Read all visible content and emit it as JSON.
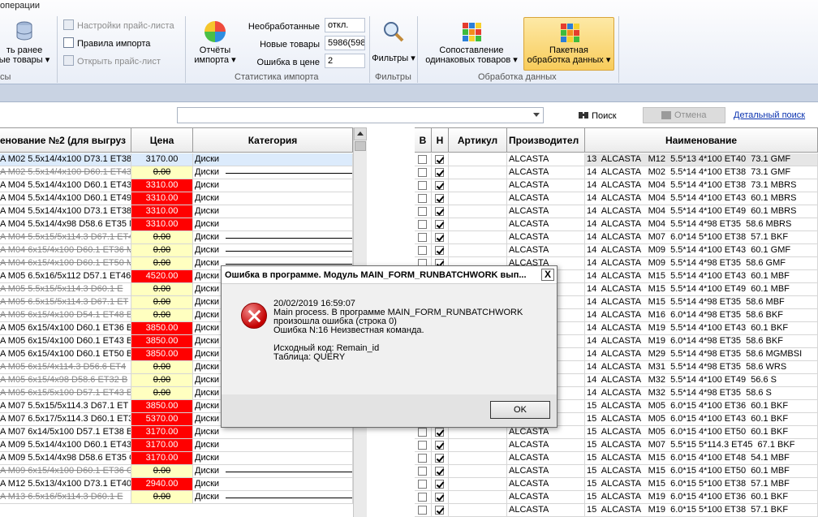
{
  "menu_label": "операции",
  "ribbon": {
    "group1": {
      "load_btn_line1": "ть ранее",
      "load_btn_line2": "ые товары",
      "caption": "сы",
      "items": [
        {
          "label": "Настройки прайс-листа",
          "disabled": true
        },
        {
          "label": "Правила импорта",
          "disabled": false
        },
        {
          "label": "Открыть прайс-лист",
          "disabled": true
        }
      ]
    },
    "stats": {
      "reports_line1": "Отчёты",
      "reports_line2": "импорта",
      "labels": [
        "Необработанные",
        "Новые товары",
        "Ошибка в цене"
      ],
      "values": [
        "откл.",
        "5986(598",
        "2"
      ],
      "caption": "Статистика импорта"
    },
    "filters": {
      "label": "Фильтры",
      "caption": "Фильтры"
    },
    "processing": {
      "compare_line1": "Сопоставление",
      "compare_line2": "одинаковых товаров",
      "batch_line1": "Пакетная",
      "batch_line2": "обработка данных",
      "caption": "Обработка данных"
    }
  },
  "toolbar": {
    "search_label": "Поиск",
    "cancel_label": "Отмена",
    "detail_link": "Детальный поиск"
  },
  "left_grid": {
    "headers": [
      "енование №2 (для выгруз",
      "Цена",
      "Категория"
    ],
    "rows": [
      {
        "name": "A M02 5.5x14/4x100 D73.1 ET38",
        "price": "3170.00",
        "ptype": "norm",
        "cat": "Диски",
        "struck": false
      },
      {
        "name": "A M02 5.5x14/4x100 D60.1 ET43",
        "price": "0.00",
        "ptype": "yel",
        "cat": "Диски",
        "struck": true
      },
      {
        "name": "A M04 5.5x14/4x100 D60.1 ET43",
        "price": "3310.00",
        "ptype": "red",
        "cat": "Диски",
        "struck": false
      },
      {
        "name": "A M04 5.5x14/4x100 D60.1 ET49",
        "price": "3310.00",
        "ptype": "red",
        "cat": "Диски",
        "struck": false
      },
      {
        "name": "A M04 5.5x14/4x100 D73.1 ET38",
        "price": "3310.00",
        "ptype": "red",
        "cat": "Диски",
        "struck": false
      },
      {
        "name": "A M04 5.5x14/4x98 D58.6 ET35 M",
        "price": "3310.00",
        "ptype": "red",
        "cat": "Диски",
        "struck": false
      },
      {
        "name": "A M04 5.5x15/5x114.3 D67.1 ET4",
        "price": "0.00",
        "ptype": "yel",
        "cat": "Диски",
        "struck": true
      },
      {
        "name": "A M04 6x15/4x100 D60.1 ET36 M",
        "price": "0.00",
        "ptype": "yel",
        "cat": "Диски",
        "struck": true
      },
      {
        "name": "A M04 6x15/4x100 D60.1 ET50 M",
        "price": "0.00",
        "ptype": "yel",
        "cat": "Диски",
        "struck": true
      },
      {
        "name": "A M05 6.5x16/5x112 D57.1 ET46",
        "price": "4520.00",
        "ptype": "red",
        "cat": "Диски",
        "struck": false
      },
      {
        "name": "A M05 5.5x15/5x114.3 D60.1 E",
        "price": "0.00",
        "ptype": "yel",
        "cat": "Диски",
        "struck": true
      },
      {
        "name": "A M05 6.5x15/5x114.3 D67.1 ET",
        "price": "0.00",
        "ptype": "yel",
        "cat": "Диски",
        "struck": true
      },
      {
        "name": "A M05 6x15/4x100 D54.1 ET48 B",
        "price": "0.00",
        "ptype": "yel",
        "cat": "Диски",
        "struck": true
      },
      {
        "name": "A M05 6x15/4x100 D60.1 ET36 BK",
        "price": "3850.00",
        "ptype": "red",
        "cat": "Диски",
        "struck": false
      },
      {
        "name": "A M05 6x15/4x100 D60.1 ET43 BK",
        "price": "3850.00",
        "ptype": "red",
        "cat": "Диски",
        "struck": false
      },
      {
        "name": "A M05 6x15/4x100 D60.1 ET50 BK",
        "price": "3850.00",
        "ptype": "red",
        "cat": "Диски",
        "struck": false
      },
      {
        "name": "A M05 6x15/4x114.3 D56.6 ET4",
        "price": "0.00",
        "ptype": "yel",
        "cat": "Диски",
        "struck": true
      },
      {
        "name": "A M05 6x15/4x98 D58.6 ET32 B",
        "price": "0.00",
        "ptype": "yel",
        "cat": "Диски",
        "struck": true
      },
      {
        "name": "A M05 6x15/5x100 D57.1 ET43 B",
        "price": "0.00",
        "ptype": "yel",
        "cat": "Диски",
        "struck": true
      },
      {
        "name": "A M07 5.5x15/5x114.3 D67.1 ET",
        "price": "3850.00",
        "ptype": "red",
        "cat": "Диски",
        "struck": false
      },
      {
        "name": "A M07 6.5x17/5x114.3 D60.1 ET3",
        "price": "5370.00",
        "ptype": "red",
        "cat": "Диски",
        "struck": false
      },
      {
        "name": "A M07 6x14/5x100 D57.1 ET38 BK",
        "price": "3170.00",
        "ptype": "red",
        "cat": "Диски",
        "struck": false
      },
      {
        "name": "A M09 5.5x14/4x100 D60.1 ET43",
        "price": "3170.00",
        "ptype": "red",
        "cat": "Диски",
        "struck": false
      },
      {
        "name": "A M09 5.5x14/4x98 D58.6 ET35 G",
        "price": "3170.00",
        "ptype": "red",
        "cat": "Диски",
        "struck": false
      },
      {
        "name": "A M09 6x15/4x100 D60.1 ET36 G",
        "price": "0.00",
        "ptype": "yel",
        "cat": "Диски",
        "struck": true
      },
      {
        "name": "A M12 5.5x13/4x100 D73.1 ET40",
        "price": "2940.00",
        "ptype": "red",
        "cat": "Диски",
        "struck": false
      },
      {
        "name": "A M13 6.5x16/5x114.3 D60.1 E",
        "price": "0.00",
        "ptype": "yel",
        "cat": "Диски",
        "struck": true
      }
    ]
  },
  "right_grid": {
    "headers": [
      "В",
      "Н",
      "Артикул",
      "Производител",
      "Наименование"
    ],
    "rows": [
      {
        "v": false,
        "n": true,
        "mfr": "ALCASTA",
        "name": "13  ALCASTA   M12  5.5*13 4*100 ET40  73.1 GMF"
      },
      {
        "v": false,
        "n": true,
        "mfr": "ALCASTA",
        "name": "14  ALCASTA   M02  5.5*14 4*100 ET38  73.1 GMF"
      },
      {
        "v": false,
        "n": true,
        "mfr": "ALCASTA",
        "name": "14  ALCASTA   M04  5.5*14 4*100 ET38  73.1 MBRS"
      },
      {
        "v": false,
        "n": true,
        "mfr": "ALCASTA",
        "name": "14  ALCASTA   M04  5.5*14 4*100 ET43  60.1 MBRS"
      },
      {
        "v": false,
        "n": true,
        "mfr": "ALCASTA",
        "name": "14  ALCASTA   M04  5.5*14 4*100 ET49  60.1 MBRS"
      },
      {
        "v": false,
        "n": true,
        "mfr": "ALCASTA",
        "name": "14  ALCASTA   M04  5.5*14 4*98 ET35  58.6 MBRS"
      },
      {
        "v": false,
        "n": true,
        "mfr": "ALCASTA",
        "name": "14  ALCASTA   M07  6.0*14 5*100 ET38  57.1 BKF"
      },
      {
        "v": false,
        "n": true,
        "mfr": "ALCASTA",
        "name": "14  ALCASTA   M09  5.5*14 4*100 ET43  60.1 GMF"
      },
      {
        "v": false,
        "n": true,
        "mfr": "ALCASTA",
        "name": "14  ALCASTA   M09  5.5*14 4*98 ET35  58.6 GMF"
      },
      {
        "v": false,
        "n": true,
        "mfr": "ALCASTA",
        "name": "14  ALCASTA   M15  5.5*14 4*100 ET43  60.1 MBF"
      },
      {
        "v": false,
        "n": true,
        "mfr": "ALCASTA",
        "name": "14  ALCASTA   M15  5.5*14 4*100 ET49  60.1 MBF"
      },
      {
        "v": false,
        "n": true,
        "mfr": "ALCASTA",
        "name": "14  ALCASTA   M15  5.5*14 4*98 ET35  58.6 MBF"
      },
      {
        "v": false,
        "n": true,
        "mfr": "ALCASTA",
        "name": "14  ALCASTA   M16  6.0*14 4*98 ET35  58.6 BKF"
      },
      {
        "v": false,
        "n": true,
        "mfr": "ALCASTA",
        "name": "14  ALCASTA   M19  5.5*14 4*100 ET43  60.1 BKF"
      },
      {
        "v": false,
        "n": true,
        "mfr": "ALCASTA",
        "name": "14  ALCASTA   M19  6.0*14 4*98 ET35  58.6 BKF"
      },
      {
        "v": false,
        "n": true,
        "mfr": "ALCASTA",
        "name": "14  ALCASTA   M29  5.5*14 4*98 ET35  58.6 MGMBSI"
      },
      {
        "v": false,
        "n": true,
        "mfr": "ALCASTA",
        "name": "14  ALCASTA   M31  5.5*14 4*98 ET35  58.6 WRS"
      },
      {
        "v": false,
        "n": true,
        "mfr": "ALCASTA",
        "name": "14  ALCASTA   M32  5.5*14 4*100 ET49  56.6 S"
      },
      {
        "v": false,
        "n": true,
        "mfr": "ALCASTA",
        "name": "14  ALCASTA   M32  5.5*14 4*98 ET35  58.6 S"
      },
      {
        "v": false,
        "n": true,
        "mfr": "ALCASTA",
        "name": "15  ALCASTA   M05  6.0*15 4*100 ET36  60.1 BKF"
      },
      {
        "v": false,
        "n": true,
        "mfr": "ALCASTA",
        "name": "15  ALCASTA   M05  6.0*15 4*100 ET43  60.1 BKF"
      },
      {
        "v": false,
        "n": true,
        "mfr": "ALCASTA",
        "name": "15  ALCASTA   M05  6.0*15 4*100 ET50  60.1 BKF"
      },
      {
        "v": false,
        "n": true,
        "mfr": "ALCASTA",
        "name": "15  ALCASTA   M07  5.5*15 5*114.3 ET45  67.1 BKF"
      },
      {
        "v": false,
        "n": true,
        "mfr": "ALCASTA",
        "name": "15  ALCASTA   M15  6.0*15 4*100 ET48  54.1 MBF"
      },
      {
        "v": false,
        "n": true,
        "mfr": "ALCASTA",
        "name": "15  ALCASTA   M15  6.0*15 4*100 ET50  60.1 MBF"
      },
      {
        "v": false,
        "n": true,
        "mfr": "ALCASTA",
        "name": "15  ALCASTA   M15  6.0*15 5*100 ET38  57.1 MBF"
      },
      {
        "v": false,
        "n": true,
        "mfr": "ALCASTA",
        "name": "15  ALCASTA   M19  6.0*15 4*100 ET36  60.1 BKF"
      },
      {
        "v": false,
        "n": true,
        "mfr": "ALCASTA",
        "name": "15  ALCASTA   M19  6.0*15 5*100 ET38  57.1 BKF"
      }
    ]
  },
  "dialog": {
    "title": "Ошибка в программе. Модуль MAIN_FORM_RUNBATCHWORK вып...",
    "close": "X",
    "lines": [
      "20/02/2019 16:59:07",
      "Main process. В программе MAIN_FORM_RUNBATCHWORK",
      "произошла ошибка (строка 0)",
      "Ошибка N:16 Неизвестная команда.",
      "",
      "Исходный код: Remain_id",
      "Таблица: QUERY"
    ],
    "ok": "OK"
  }
}
